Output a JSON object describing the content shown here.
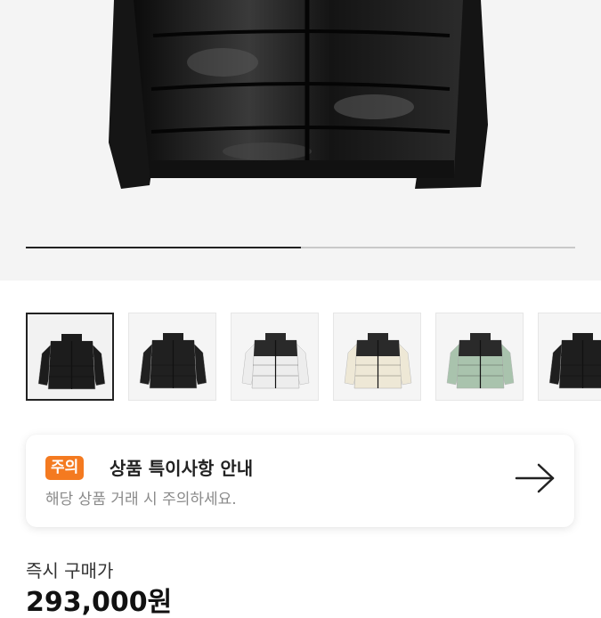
{
  "product": {
    "image_alt": "black puffer jacket",
    "gallery_progress": 0.5,
    "thumbnails": [
      {
        "icon": "jacket-black-shiny",
        "body": "#1c1c1c",
        "yoke": "#1c1c1c",
        "bg": "#f2f2f2",
        "selected": true
      },
      {
        "icon": "jacket-black-matte",
        "body": "#202020",
        "yoke": "#202020",
        "bg": "#f5f5f5",
        "selected": false
      },
      {
        "icon": "jacket-white",
        "body": "#ededed",
        "yoke": "#2a2a2a",
        "bg": "#f5f5f5",
        "selected": false
      },
      {
        "icon": "jacket-cream",
        "body": "#eee8d6",
        "yoke": "#2a2a2a",
        "bg": "#f5f5f5",
        "selected": false
      },
      {
        "icon": "jacket-sage",
        "body": "#a9c3ad",
        "yoke": "#2a2a2a",
        "bg": "#f5f5f5",
        "selected": false
      },
      {
        "icon": "jacket-black",
        "body": "#1e1e1e",
        "yoke": "#1e1e1e",
        "bg": "#f5f5f5",
        "selected": false
      }
    ]
  },
  "notice": {
    "badge": "주의",
    "title": "상품 특이사항 안내",
    "subtitle": "해당 상품 거래 시 주의하세요.",
    "arrow_icon": "arrow-right-icon",
    "badge_color": "#f47a20"
  },
  "price": {
    "label": "즉시 구매가",
    "value": "293,000원"
  }
}
